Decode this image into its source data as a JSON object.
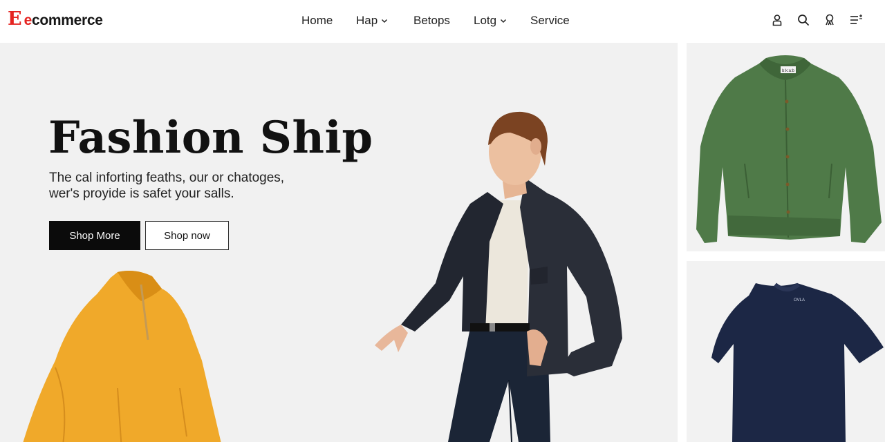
{
  "brand": {
    "mark": "E",
    "first_letter": "e",
    "rest": "commerce",
    "color": "#e52421"
  },
  "nav": {
    "items": [
      {
        "label": "Home",
        "has_dropdown": false
      },
      {
        "label": "Hap",
        "has_dropdown": true
      },
      {
        "label": "Betops",
        "has_dropdown": false
      },
      {
        "label": "Lotg",
        "has_dropdown": true
      },
      {
        "label": "Service",
        "has_dropdown": false
      }
    ]
  },
  "tools": [
    {
      "icon": "user-icon"
    },
    {
      "icon": "search-icon"
    },
    {
      "icon": "account-icon"
    },
    {
      "icon": "menu-icon"
    }
  ],
  "hero": {
    "title": "Fashion Ship",
    "subtitle_lines": [
      "The cal inforting feaths, our or chatoges,",
      "wer's proyide is safet your salls."
    ],
    "primary_button": "Shop More",
    "secondary_button": "Shop now"
  },
  "products": [
    {
      "name": "green-bomber-jacket",
      "tag": "b:k:a:b",
      "color": "#4f7a48"
    },
    {
      "name": "navy-tshirt",
      "tag": "OVLA",
      "color": "#1c2745"
    },
    {
      "name": "yellow-half-zip-pullover",
      "color": "#f0a92a"
    }
  ]
}
